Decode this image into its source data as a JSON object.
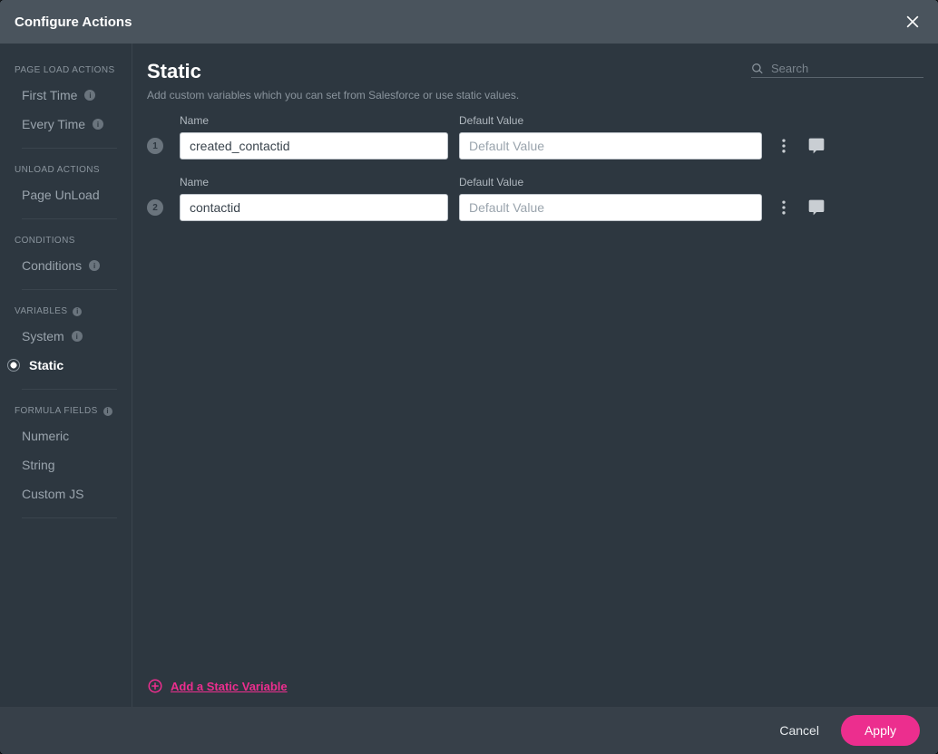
{
  "title": "Configure Actions",
  "sidebar": {
    "sections": [
      {
        "heading": "PAGE LOAD ACTIONS",
        "info": false,
        "items": [
          {
            "label": "First Time",
            "info": true,
            "active": false
          },
          {
            "label": "Every Time",
            "info": true,
            "active": false
          }
        ]
      },
      {
        "heading": "UNLOAD ACTIONS",
        "info": false,
        "items": [
          {
            "label": "Page UnLoad",
            "info": false,
            "active": false
          }
        ]
      },
      {
        "heading": "CONDITIONS",
        "info": false,
        "items": [
          {
            "label": "Conditions",
            "info": true,
            "active": false
          }
        ]
      },
      {
        "heading": "VARIABLES",
        "info": true,
        "items": [
          {
            "label": "System",
            "info": true,
            "active": false
          },
          {
            "label": "Static",
            "info": false,
            "active": true
          }
        ]
      },
      {
        "heading": "FORMULA FIELDS",
        "info": true,
        "items": [
          {
            "label": "Numeric",
            "info": false,
            "active": false
          },
          {
            "label": "String",
            "info": false,
            "active": false
          },
          {
            "label": "Custom JS",
            "info": false,
            "active": false
          }
        ]
      }
    ]
  },
  "main": {
    "title": "Static",
    "subtitle": "Add custom variables which you can set from Salesforce or use static values.",
    "search_placeholder": "Search",
    "labels": {
      "name": "Name",
      "default": "Default Value"
    },
    "default_placeholder": "Default Value",
    "rows": [
      {
        "num": "1",
        "name": "created_contactid",
        "default": ""
      },
      {
        "num": "2",
        "name": "contactid",
        "default": ""
      }
    ],
    "add_label": "Add a Static Variable"
  },
  "footer": {
    "cancel": "Cancel",
    "apply": "Apply"
  }
}
